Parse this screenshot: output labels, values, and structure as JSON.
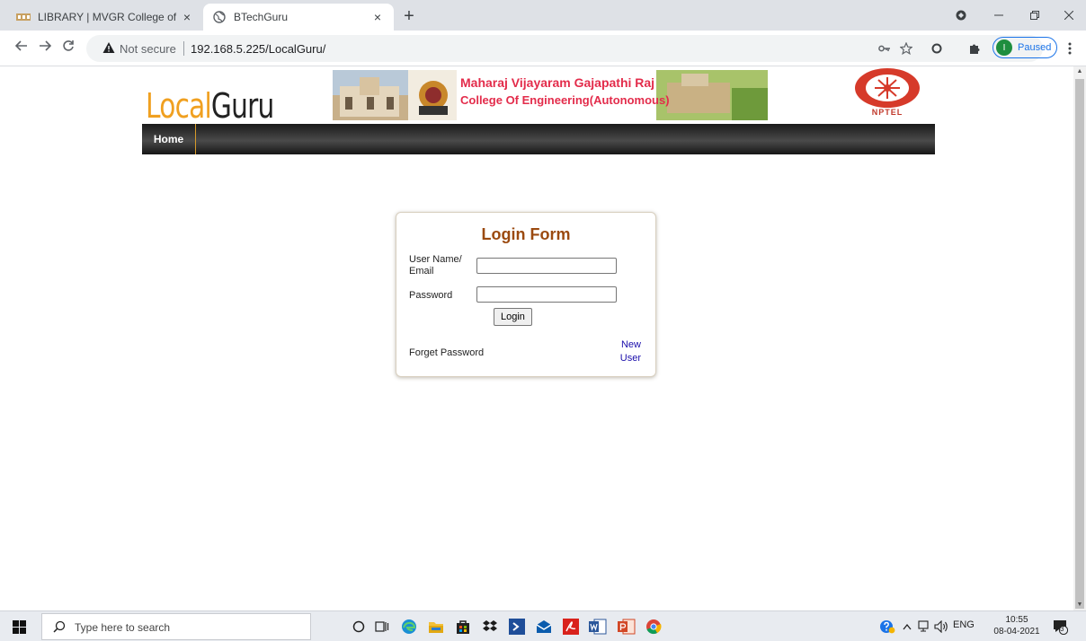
{
  "browser": {
    "tabs": [
      {
        "title": "LIBRARY | MVGR College of Engi",
        "active": false
      },
      {
        "title": "BTechGuru",
        "active": true
      }
    ],
    "tab_close": "×",
    "new_tab": "+",
    "security_label": "Not secure",
    "url": "192.168.5.225/LocalGuru/",
    "profile_initial": "I",
    "profile_status": "Paused"
  },
  "header": {
    "logo_part1": "Local",
    "logo_part2": "Guru",
    "banner_line1": "Maharaj Vijayaram Gajapathi Raj",
    "banner_line2": "College Of Engineering(Autonomous)",
    "partner_logo_text": "NPTEL"
  },
  "nav": {
    "home": "Home"
  },
  "login": {
    "title": "Login Form",
    "username_label_line1": "User Name/",
    "username_label_line2": "Email",
    "username_value": "",
    "password_label": "Password",
    "password_value": "",
    "submit_label": "Login",
    "forgot_link": "Forget Password",
    "new_user_line1": "New",
    "new_user_line2": "User"
  },
  "taskbar": {
    "search_placeholder": "Type here to search",
    "language": "ENG",
    "time": "10:55",
    "date": "08-04-2021",
    "notification_count": "3"
  },
  "colors": {
    "logo_accent": "#f0a020",
    "login_title": "#9b4a10",
    "menu_divider": "#d69a2a",
    "link": "#1a0dab"
  }
}
